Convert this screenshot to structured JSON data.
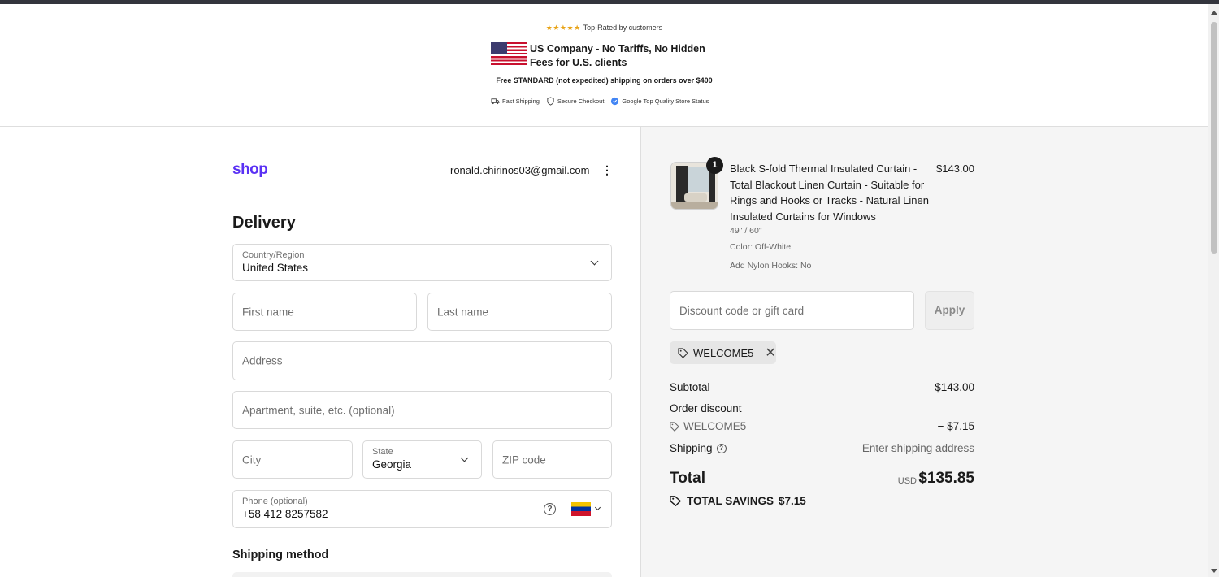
{
  "banner": {
    "stars": "★★★★★",
    "rated_text": "Top-Rated by customers",
    "us_line": "US Company - No Tariffs, No Hidden Fees for U.S. clients",
    "free_shipping": "Free STANDARD (not expedited) shipping on orders over $400",
    "badges": [
      "Fast Shipping",
      "Secure Checkout",
      "Google Top Quality Store Status"
    ]
  },
  "header": {
    "logo": "shop",
    "email": "ronald.chirinos03@gmail.com",
    "menu_glyph": "⋮"
  },
  "delivery": {
    "title": "Delivery",
    "country": {
      "label": "Country/Region",
      "value": "United States"
    },
    "first_name": {
      "placeholder": "First name"
    },
    "last_name": {
      "placeholder": "Last name"
    },
    "address": {
      "placeholder": "Address"
    },
    "apartment": {
      "placeholder": "Apartment, suite, etc. (optional)"
    },
    "city": {
      "placeholder": "City"
    },
    "state": {
      "label": "State",
      "value": "Georgia"
    },
    "zip": {
      "placeholder": "ZIP code"
    },
    "phone": {
      "label": "Phone (optional)",
      "value": "+58 412 8257582"
    }
  },
  "shipping_method": {
    "title": "Shipping method"
  },
  "summary": {
    "item": {
      "quantity": "1",
      "name": "Black S-fold Thermal Insulated Curtain - Total Blackout Linen Curtain - Suitable for Rings and Hooks or Tracks - Natural Linen Insulated Curtains for Windows",
      "price": "$143.00",
      "size": "49\" / 60\"",
      "color": "Color: Off-White",
      "hooks": "Add Nylon Hooks: No"
    },
    "discount_placeholder": "Discount code or gift card",
    "apply_label": "Apply",
    "applied_code": "WELCOME5",
    "subtotal_label": "Subtotal",
    "subtotal_value": "$143.00",
    "order_discount_label": "Order discount",
    "discount_code": "WELCOME5",
    "discount_value": "− $7.15",
    "shipping_label": "Shipping",
    "shipping_value": "Enter shipping address",
    "total_label": "Total",
    "currency": "USD",
    "total_value": "$135.85",
    "savings_label": "TOTAL SAVINGS",
    "savings_value": "$7.15"
  }
}
